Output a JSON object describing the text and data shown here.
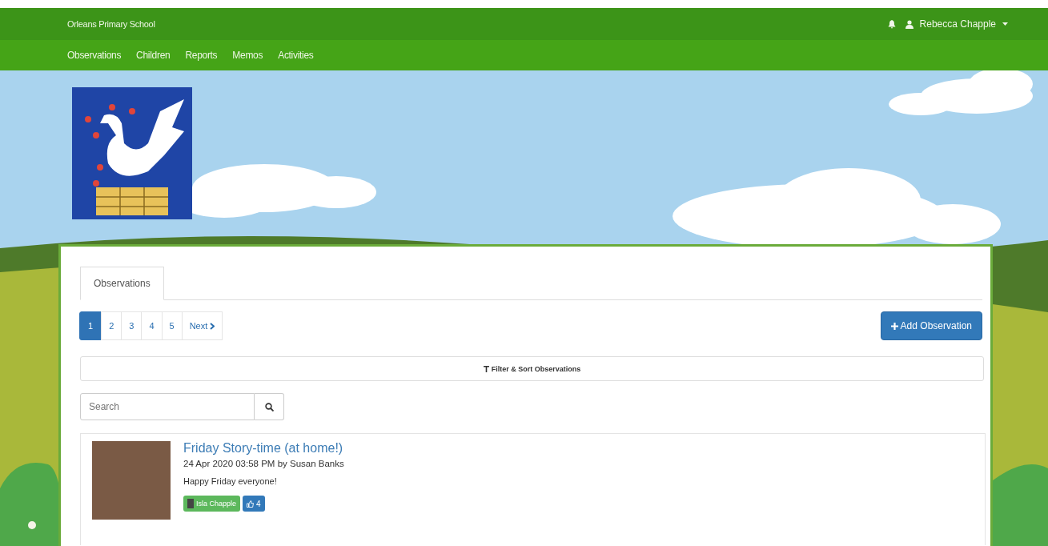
{
  "header": {
    "school_name": "Orleans Primary School",
    "user_name": "Rebecca Chapple"
  },
  "nav": [
    "Observations",
    "Children",
    "Reports",
    "Memos",
    "Activities"
  ],
  "tabs": [
    {
      "label": "Observations",
      "selected": true
    }
  ],
  "pagination": {
    "pages": [
      {
        "label": "1",
        "selected": true
      },
      {
        "label": "2",
        "selected": false
      },
      {
        "label": "3",
        "selected": false
      },
      {
        "label": "4",
        "selected": false
      },
      {
        "label": "5",
        "selected": false
      }
    ],
    "next": "Next"
  },
  "add_button": "Add Observation",
  "filter_button": "Filter & Sort Observations",
  "search": {
    "placeholder": "Search"
  },
  "observations": [
    {
      "title": "Friday Story-time (at home!)",
      "meta": "24 Apr 2020 03:58 PM by Susan Banks",
      "text": "Happy Friday everyone!",
      "child_tag": "Isla Chapple",
      "likes": "4"
    }
  ]
}
